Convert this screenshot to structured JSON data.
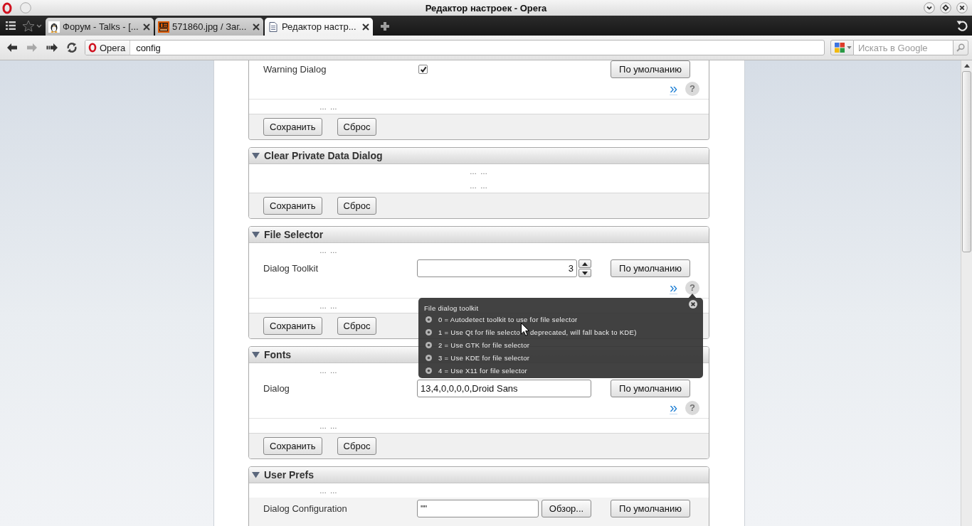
{
  "window": {
    "title": "Редактор настроек - Opera"
  },
  "tabs": [
    {
      "label": "Форум - Talks - [...",
      "kind": "forum",
      "selected": false
    },
    {
      "label": "571860.jpg / Заг...",
      "kind": "image",
      "selected": false
    },
    {
      "label": "Редактор настр...",
      "kind": "document",
      "selected": true
    }
  ],
  "nav_buttons": [
    {
      "kind": "back",
      "disabled": false
    },
    {
      "kind": "forward",
      "disabled": true
    },
    {
      "kind": "fast_forward",
      "disabled": false
    },
    {
      "kind": "reload",
      "disabled": false
    }
  ],
  "address": {
    "badge": "Opera",
    "value": "config"
  },
  "search": {
    "placeholder": "Искать в Google"
  },
  "sections": [
    {
      "items": [
        {
          "kind": "setting",
          "label": "Warning Dialog",
          "highlighted": false,
          "control": {
            "kind": "checkbox",
            "checked": true
          },
          "default_button": "По умолчанию",
          "expand": "»",
          "help": "?"
        },
        {
          "kind": "ellipsis",
          "text": "… …"
        }
      ],
      "buttons": [
        "Сохранить",
        "Сброс"
      ]
    },
    {
      "title": "Clear Private Data Dialog",
      "expanded": true,
      "items": [
        {
          "kind": "ellipsis",
          "text": "… …"
        },
        {
          "kind": "ellipsis",
          "text": "… …"
        }
      ],
      "buttons": [
        "Сохранить",
        "Сброс"
      ]
    },
    {
      "title": "File Selector",
      "expanded": true,
      "items": [
        {
          "kind": "ellipsis",
          "text": "… …"
        },
        {
          "kind": "setting",
          "label": "Dialog Toolkit",
          "highlighted": false,
          "control": {
            "kind": "number",
            "value": "3"
          },
          "default_button": "По умолчанию",
          "expand": "»",
          "help": "?",
          "tooltip": {
            "title": "File dialog toolkit",
            "options": [
              {
                "text": "0 = Autodetect toolkit to use for file selector"
              },
              {
                "text": "1 = Use Qt for file selecto",
                "text_after_pointer": "deprecated, will fall back to KDE)"
              },
              {
                "text": "2 = Use GTK for file selector"
              },
              {
                "text": "3 = Use KDE for file selector"
              },
              {
                "text": "4 = Use X11 for file selector"
              }
            ]
          }
        },
        {
          "kind": "ellipsis",
          "text": "… …"
        }
      ],
      "buttons": [
        "Сохранить",
        "Сброс"
      ]
    },
    {
      "title": "Fonts",
      "expanded": true,
      "items": [
        {
          "kind": "ellipsis",
          "text": "… …"
        },
        {
          "kind": "setting",
          "label": "Dialog",
          "highlighted": false,
          "control": {
            "kind": "text",
            "value": "13,4,0,0,0,0,Droid Sans"
          },
          "default_button": "По умолчанию",
          "expand": "»",
          "help": "?"
        },
        {
          "kind": "ellipsis",
          "text": "… …"
        }
      ],
      "buttons": [
        "Сохранить",
        "Сброс"
      ]
    },
    {
      "title": "User Prefs",
      "expanded": true,
      "items": [
        {
          "kind": "ellipsis",
          "text": "… …"
        },
        {
          "kind": "setting",
          "label": "Dialog Configuration",
          "highlighted": true,
          "control": {
            "kind": "file",
            "value": "\"\"",
            "browse_button": "Обзор..."
          },
          "default_button": "По умолчанию"
        }
      ]
    }
  ]
}
